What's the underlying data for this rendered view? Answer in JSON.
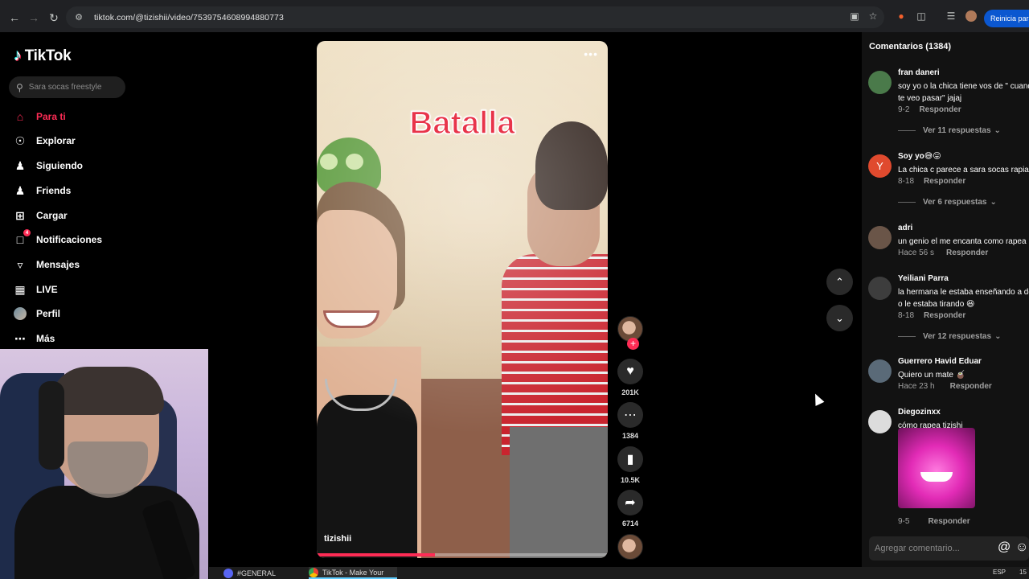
{
  "browser": {
    "url": "tiktok.com/@tizishii/video/7539754608994880773",
    "restart_label": "Reinicia para actualizar"
  },
  "sidebar": {
    "logo": "TikTok",
    "search_placeholder": "Sara socas freestyle",
    "items": [
      {
        "label": "Para ti",
        "icon": "home-icon"
      },
      {
        "label": "Explorar",
        "icon": "compass-icon"
      },
      {
        "label": "Siguiendo",
        "icon": "user-plus-icon"
      },
      {
        "label": "Friends",
        "icon": "friends-icon"
      },
      {
        "label": "Cargar",
        "icon": "upload-icon"
      },
      {
        "label": "Notificaciones",
        "icon": "inbox-icon",
        "badge": "4"
      },
      {
        "label": "Mensajes",
        "icon": "send-icon"
      },
      {
        "label": "LIVE",
        "icon": "live-icon"
      },
      {
        "label": "Perfil",
        "icon": "avatar"
      },
      {
        "label": "Más",
        "icon": "more-icon"
      }
    ]
  },
  "video": {
    "caption": "Batalla",
    "author": "tizishii",
    "progress": 0.405
  },
  "actions": {
    "likes": "201K",
    "comments": "1384",
    "saves": "10.5K",
    "shares": "6714"
  },
  "comments": {
    "header": "Comentarios (1384)",
    "reply_label": "Responder",
    "items": [
      {
        "user": "fran daneri",
        "text": "soy yo o la chica tiene vos de \" cuando\nte veo pasar\" jajaj",
        "date": "9-2",
        "more": "Ver 11 respuestas",
        "avatar_color": "#4a7a4a"
      },
      {
        "user": "Soy yo😅😛",
        "text": "La chica c parece a sara socas rapiando",
        "date": "8-18",
        "more": "Ver 6 respuestas",
        "avatar_color": "#e04a2e",
        "avatar_letter": "Y"
      },
      {
        "user": "adri",
        "text": "un genio el me encanta como rapea",
        "date": "Hace 56 s",
        "avatar_color": "#6a5548"
      },
      {
        "user": "Yeiliani Parra",
        "text": "la hermana le estaba enseñando a dec\no le estaba tirando 😆",
        "date": "8-18",
        "more": "Ver 12 respuestas",
        "avatar_color": "#3d3d3d"
      },
      {
        "user": "Guerrero Havid Eduar",
        "text": "Quiero un mate 🧉",
        "date": "Hace 23 h",
        "avatar_color": "#5a6a78"
      },
      {
        "user": "Diegozinxx",
        "text": "cómo rapea tizishi",
        "date": "9-5",
        "avatar_color": "#dcdcdc"
      }
    ]
  },
  "comment_input": {
    "placeholder": "Agregar comentario..."
  },
  "taskbar": {
    "item1": "#GENERAL",
    "item2": "TikTok - Make Your",
    "lang": "ESP",
    "time": "15"
  }
}
